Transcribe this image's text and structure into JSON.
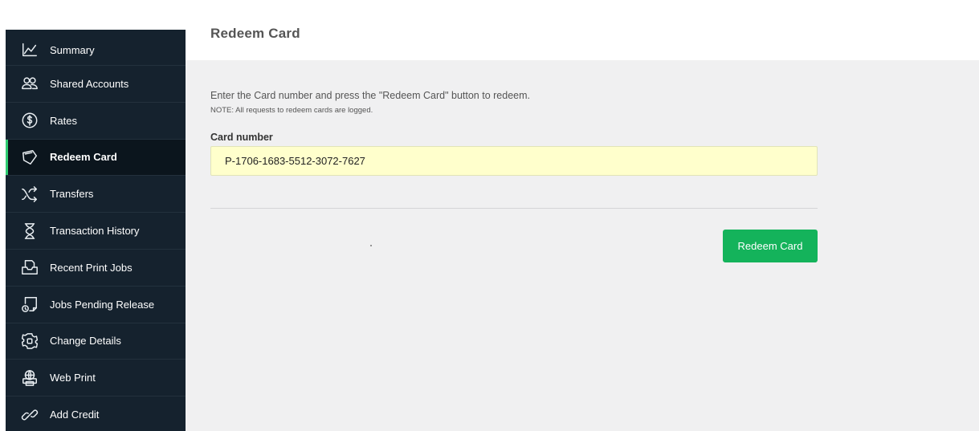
{
  "sidebar": {
    "items": [
      {
        "label": "Summary",
        "icon": "chart-icon",
        "active": false
      },
      {
        "label": "Shared Accounts",
        "icon": "users-icon",
        "active": false
      },
      {
        "label": "Rates",
        "icon": "dollar-icon",
        "active": false
      },
      {
        "label": "Redeem Card",
        "icon": "card-icon",
        "active": true
      },
      {
        "label": "Transfers",
        "icon": "shuffle-icon",
        "active": false
      },
      {
        "label": "Transaction History",
        "icon": "hourglass-icon",
        "active": false
      },
      {
        "label": "Recent Print Jobs",
        "icon": "printer-tray-icon",
        "active": false
      },
      {
        "label": "Jobs Pending Release",
        "icon": "pending-print-icon",
        "active": false
      },
      {
        "label": "Change Details",
        "icon": "settings-icon",
        "active": false
      },
      {
        "label": "Web Print",
        "icon": "web-print-icon",
        "active": false
      },
      {
        "label": "Add Credit",
        "icon": "link-icon",
        "active": false
      }
    ]
  },
  "header": {
    "title": "Redeem Card"
  },
  "main": {
    "instructions": "Enter the Card number and press the \"Redeem Card\" button to redeem.",
    "note": "NOTE: All requests to redeem cards are logged.",
    "card_label": "Card number",
    "card_value": "P-1706-1683-5512-3072-7627",
    "redeem_label": "Redeem Card"
  },
  "colors": {
    "sidebar_bg": "#15222e",
    "active_accent": "#2ecc71",
    "button_green": "#14b35b",
    "input_bg": "#ffffcc",
    "content_bg": "#f0f0f1"
  }
}
